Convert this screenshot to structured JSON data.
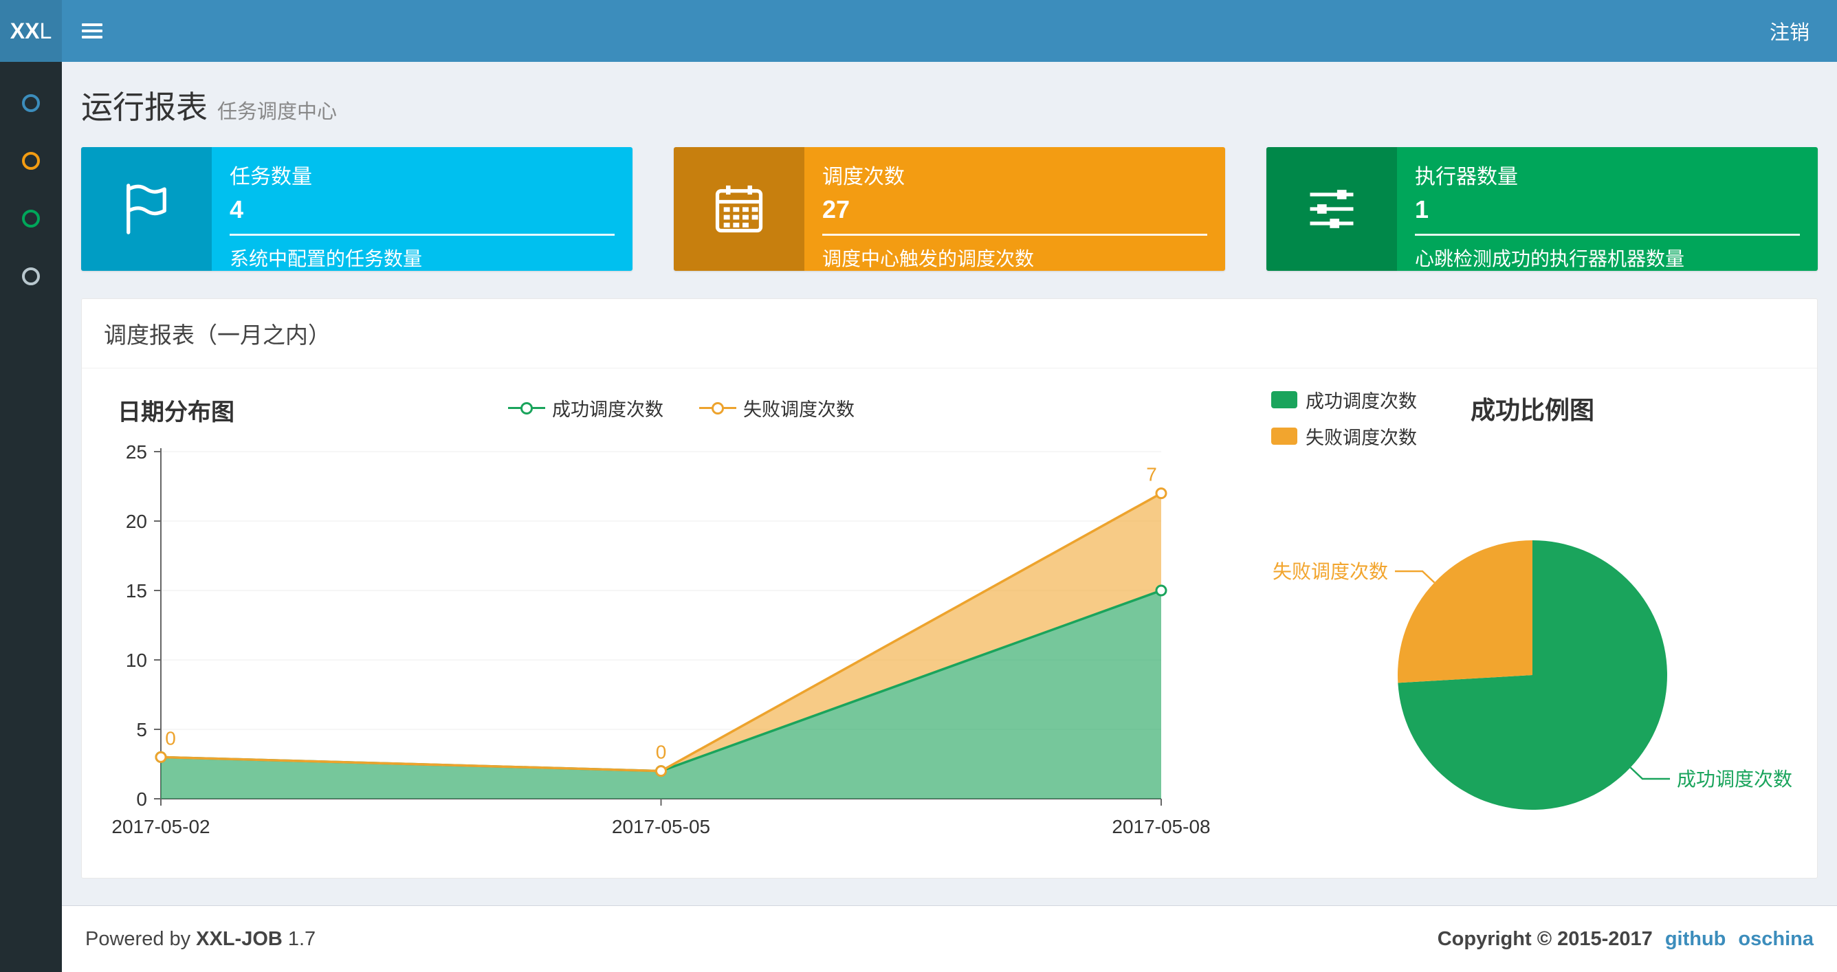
{
  "nav": {
    "logo_bold": "XX",
    "logo_rest": "L",
    "logout": "注销"
  },
  "sidebar": {
    "items": [
      {
        "color": "#3c8dbc"
      },
      {
        "color": "#f39c12"
      },
      {
        "color": "#00a65a"
      },
      {
        "color": "#b8c7ce"
      }
    ]
  },
  "header": {
    "title": "运行报表",
    "subtitle": "任务调度中心"
  },
  "info_boxes": [
    {
      "label": "任务数量",
      "value": "4",
      "desc": "系统中配置的任务数量",
      "bg": "#00c0ef",
      "icon": "flag-icon"
    },
    {
      "label": "调度次数",
      "value": "27",
      "desc": "调度中心触发的调度次数",
      "bg": "#f39c12",
      "icon": "calendar-icon"
    },
    {
      "label": "执行器数量",
      "value": "1",
      "desc": "心跳检测成功的执行器机器数量",
      "bg": "#00a65a",
      "icon": "sliders-icon"
    }
  ],
  "panel": {
    "title": "调度报表（一月之内）"
  },
  "chart_data": [
    {
      "type": "area",
      "title": "日期分布图",
      "x": [
        "2017-05-02",
        "2017-05-05",
        "2017-05-08"
      ],
      "series": [
        {
          "name": "成功调度次数",
          "values": [
            3,
            2,
            15
          ],
          "color": "#1aa45c",
          "fill": "rgba(34,164,94,0.62)"
        },
        {
          "name": "失败调度次数",
          "values": [
            0,
            0,
            7
          ],
          "color": "#eda32d",
          "fill": "rgba(242,171,60,0.62)"
        }
      ],
      "stacked": true,
      "ylim": [
        0,
        25
      ],
      "yticks": [
        0,
        5,
        10,
        15,
        20,
        25
      ],
      "point_labels": [
        "0",
        "0",
        "7"
      ],
      "legend_position": "top",
      "grid": true
    },
    {
      "type": "pie",
      "title": "成功比例图",
      "slices": [
        {
          "name": "成功调度次数",
          "value": 20,
          "color": "#1aa45c"
        },
        {
          "name": "失败调度次数",
          "value": 7,
          "color": "#f2a52e"
        }
      ],
      "legend_position": "top-left"
    }
  ],
  "footer": {
    "powered_by": "Powered by",
    "brand": "XXL-JOB",
    "version": "1.7",
    "copyright": "Copyright © 2015-2017",
    "links": [
      {
        "label": "github"
      },
      {
        "label": "oschina"
      }
    ]
  }
}
